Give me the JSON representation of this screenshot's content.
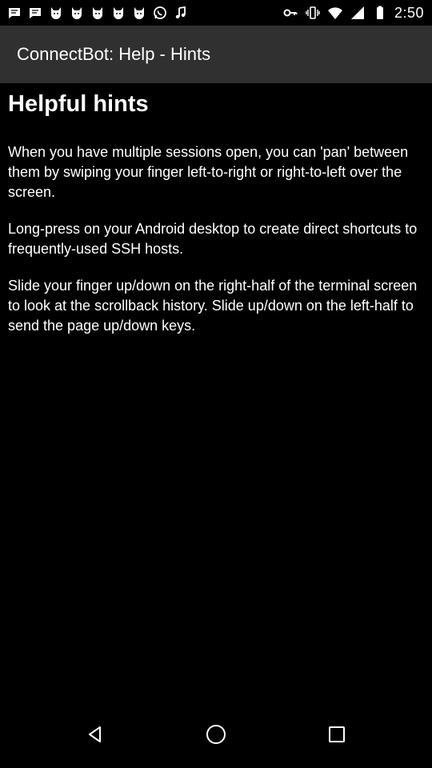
{
  "status_bar": {
    "time": "2:50",
    "left_icons": [
      "message-icon",
      "message-icon",
      "cat-icon",
      "cat-icon",
      "cat-icon",
      "cat-icon",
      "cat-icon",
      "whatsapp-icon",
      "music-note-icon"
    ],
    "right_icons": [
      "key-icon",
      "vibrate-icon",
      "wifi-icon",
      "signal-icon",
      "battery-icon"
    ]
  },
  "action_bar": {
    "title": "ConnectBot: Help - Hints"
  },
  "content": {
    "heading": "Helpful hints",
    "paragraphs": [
      "When you have multiple sessions open, you can 'pan' between them by swiping your finger left-to-right or right-to-left over the screen.",
      "Long-press on your Android desktop to create direct shortcuts to frequently-used SSH hosts.",
      "Slide your finger up/down on the right-half of the terminal screen to look at the scrollback history. Slide up/down on the left-half to send the page up/down keys."
    ]
  },
  "nav_bar": {
    "buttons": [
      "back-icon",
      "home-icon",
      "recents-icon"
    ]
  },
  "colors": {
    "background": "#000000",
    "action_bar": "#303030",
    "text": "#ffffff"
  }
}
